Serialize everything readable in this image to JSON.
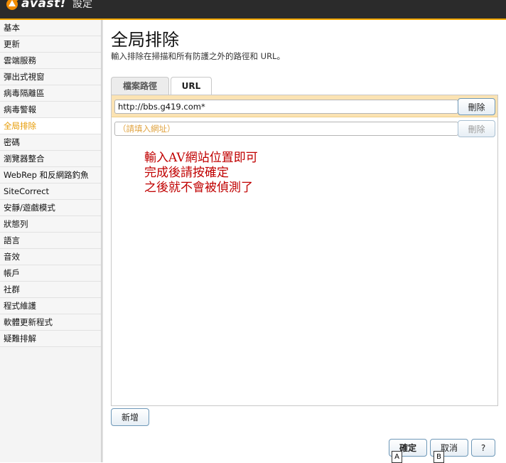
{
  "window": {
    "brand": "avast!",
    "title": "設定"
  },
  "sidebar": {
    "items": [
      {
        "label": "基本"
      },
      {
        "label": "更新"
      },
      {
        "label": "雲端服務"
      },
      {
        "label": "彈出式視窗"
      },
      {
        "label": "病毒隔離區"
      },
      {
        "label": "病毒警報"
      },
      {
        "label": "全局排除",
        "active": true
      },
      {
        "label": "密碼"
      },
      {
        "label": "瀏覽器整合"
      },
      {
        "label": "WebRep 和反網路釣魚"
      },
      {
        "label": "SiteCorrect"
      },
      {
        "label": "安靜/遊戲模式"
      },
      {
        "label": "狀態列"
      },
      {
        "label": "語言"
      },
      {
        "label": "音效"
      },
      {
        "label": "帳戶"
      },
      {
        "label": "社群"
      },
      {
        "label": "程式維護"
      },
      {
        "label": "軟體更新程式"
      },
      {
        "label": "疑難排解"
      }
    ]
  },
  "main": {
    "title": "全局排除",
    "description": "輸入排除在掃描和所有防護之外的路徑和 URL。",
    "tabs": [
      {
        "label": "檔案路徑"
      },
      {
        "label": "URL",
        "active": true
      }
    ],
    "url_list": [
      {
        "value": "http://bbs.g419.com*",
        "delete_label": "刪除"
      },
      {
        "value": "",
        "placeholder": "（請填入網址）",
        "delete_label": "刪除"
      }
    ],
    "annotation": {
      "line1": "輸入AV網站位置即可",
      "line2": "完成後請按確定",
      "line3": "之後就不會被偵測了"
    },
    "add_label": "新增"
  },
  "footer": {
    "ok_label": "確定",
    "cancel_label": "取消",
    "help_label": "?",
    "hint_a": "A",
    "hint_b": "B"
  },
  "colors": {
    "accent": "#e69a00",
    "titlebar": "#2b2b2b",
    "selected_row": "#fbe3b3",
    "annotation": "#c00000"
  }
}
